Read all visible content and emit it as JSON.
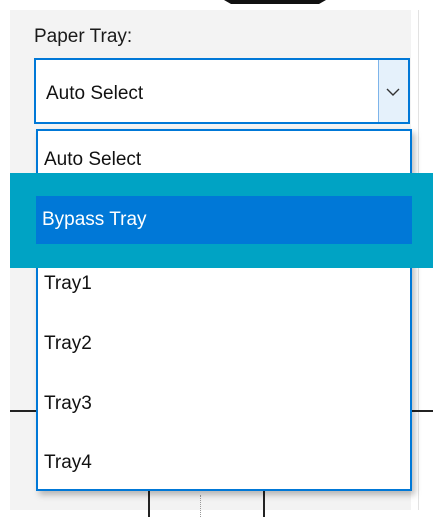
{
  "paper_tray": {
    "label": "Paper Tray:",
    "selected_value": "Auto Select",
    "options": [
      "Auto Select",
      "Bypass Tray",
      "Tray1",
      "Tray2",
      "Tray3",
      "Tray4"
    ],
    "highlighted_option": "Bypass Tray"
  },
  "colors": {
    "accent": "#0078d7",
    "annotation_highlight": "#00a3c4"
  }
}
